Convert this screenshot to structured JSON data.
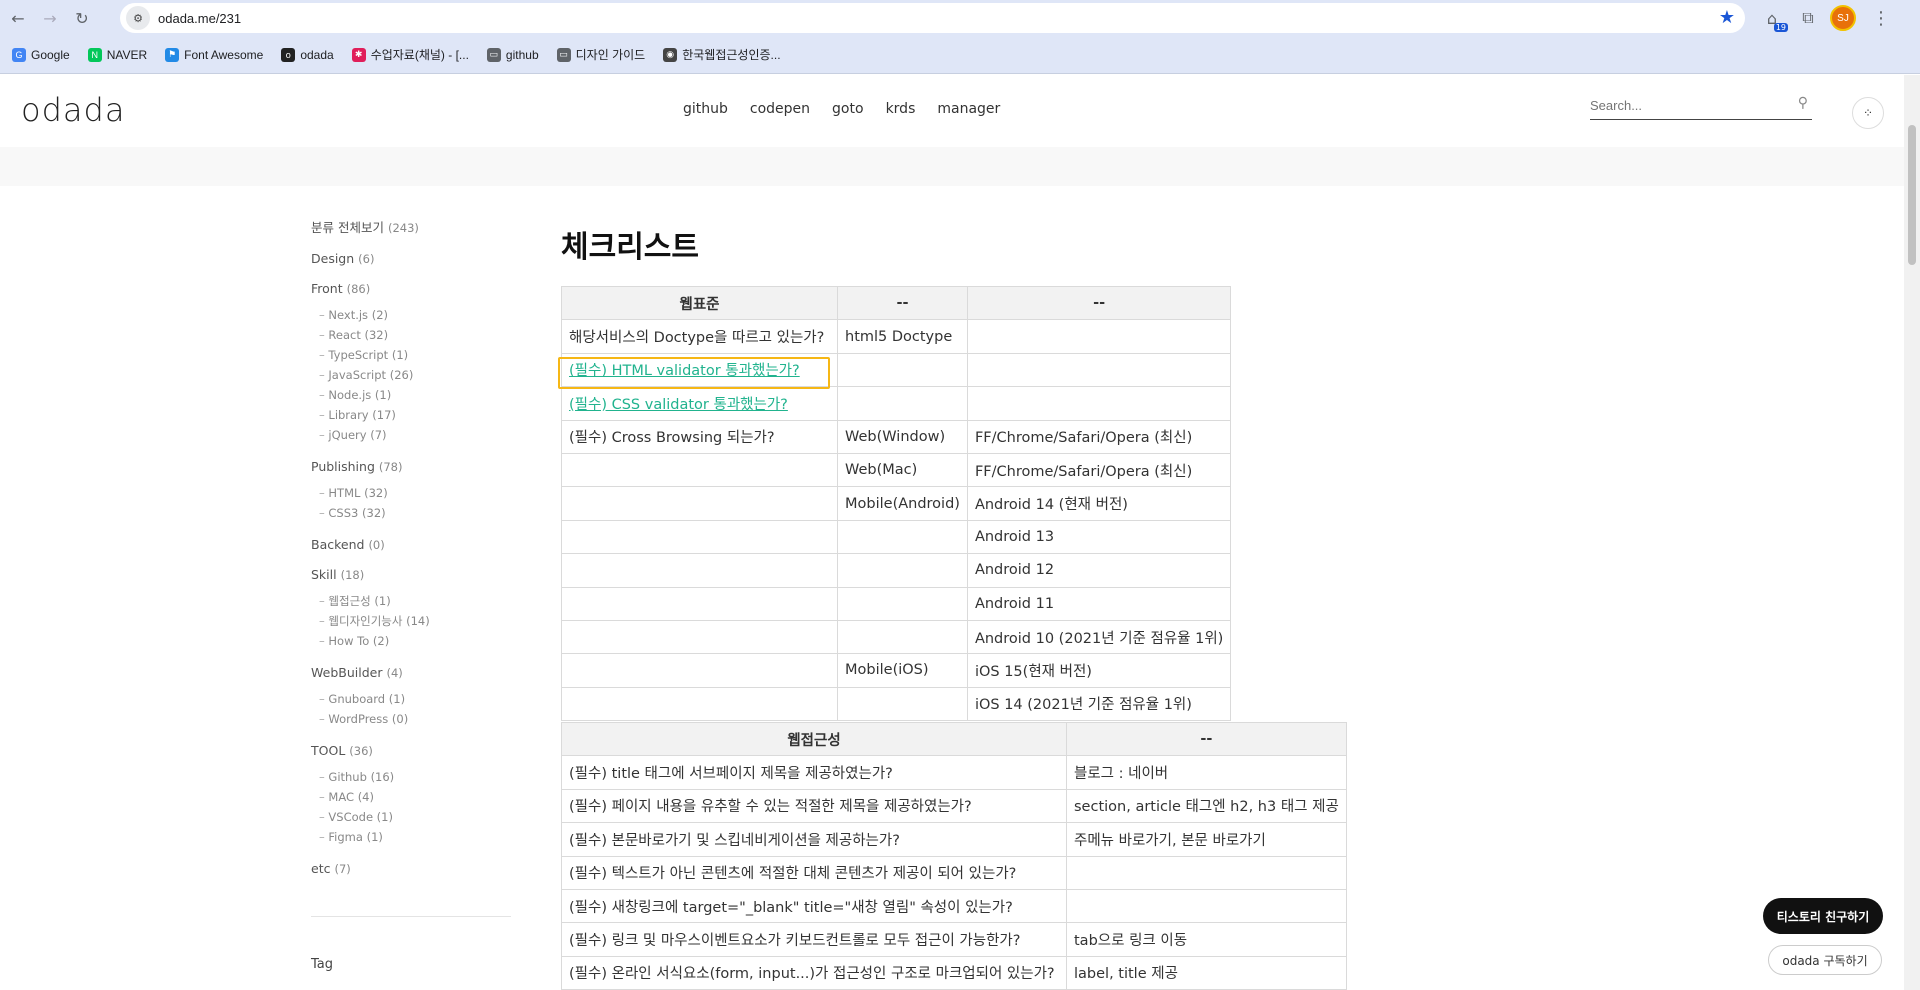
{
  "browser": {
    "url": "odada.me/231",
    "bookmarks": [
      {
        "label": "Google",
        "icon": "google-icon",
        "color": "#4285f4",
        "glyph": "G"
      },
      {
        "label": "NAVER",
        "icon": "naver-icon",
        "color": "#03c75a",
        "glyph": "N"
      },
      {
        "label": "Font Awesome",
        "icon": "flag-icon",
        "color": "#228ae6",
        "glyph": "⚑"
      },
      {
        "label": "odada",
        "icon": "odada-icon",
        "color": "#222222",
        "glyph": "o"
      },
      {
        "label": "수업자료(채널) - [...",
        "icon": "slack-icon",
        "color": "#e01e5a",
        "glyph": "✱"
      },
      {
        "label": "github",
        "icon": "folder-icon",
        "color": "#5f6368",
        "glyph": "▭"
      },
      {
        "label": "디자인 가이드",
        "icon": "folder-icon",
        "color": "#5f6368",
        "glyph": "▭"
      },
      {
        "label": "한국웹접근성인증...",
        "icon": "globe-icon",
        "color": "#444444",
        "glyph": "◉"
      }
    ],
    "extension_badge": "19",
    "profile_initials": "SJ"
  },
  "header": {
    "logo": "odada",
    "nav": [
      "github",
      "codepen",
      "goto",
      "krds",
      "manager"
    ],
    "search_placeholder": "Search..."
  },
  "sidebar": {
    "categories": [
      {
        "label": "분류 전체보기",
        "count": "(243)",
        "subs": []
      },
      {
        "label": "Design",
        "count": "(6)",
        "subs": []
      },
      {
        "label": "Front",
        "count": "(86)",
        "subs": [
          {
            "label": "Next.js",
            "count": "(2)"
          },
          {
            "label": "React",
            "count": "(32)"
          },
          {
            "label": "TypeScript",
            "count": "(1)"
          },
          {
            "label": "JavaScript",
            "count": "(26)"
          },
          {
            "label": "Node.js",
            "count": "(1)"
          },
          {
            "label": "Library",
            "count": "(17)"
          },
          {
            "label": "jQuery",
            "count": "(7)"
          }
        ]
      },
      {
        "label": "Publishing",
        "count": "(78)",
        "subs": [
          {
            "label": "HTML",
            "count": "(32)"
          },
          {
            "label": "CSS3",
            "count": "(32)"
          }
        ]
      },
      {
        "label": "Backend",
        "count": "(0)",
        "subs": []
      },
      {
        "label": "Skill",
        "count": "(18)",
        "subs": [
          {
            "label": "웹접근성",
            "count": "(1)"
          },
          {
            "label": "웹디자인기능사",
            "count": "(14)"
          },
          {
            "label": "How To",
            "count": "(2)"
          }
        ]
      },
      {
        "label": "WebBuilder",
        "count": "(4)",
        "subs": [
          {
            "label": "Gnuboard",
            "count": "(1)"
          },
          {
            "label": "WordPress",
            "count": "(0)"
          }
        ]
      },
      {
        "label": "TOOL",
        "count": "(36)",
        "subs": [
          {
            "label": "Github",
            "count": "(16)"
          },
          {
            "label": "MAC",
            "count": "(4)"
          },
          {
            "label": "VSCode",
            "count": "(1)"
          },
          {
            "label": "Figma",
            "count": "(1)"
          }
        ]
      },
      {
        "label": "etc",
        "count": "(7)",
        "subs": []
      }
    ],
    "tag_title": "Tag"
  },
  "post": {
    "title": "체크리스트",
    "table1": {
      "headers": [
        "웹표준",
        "--",
        "--"
      ],
      "rows": [
        [
          "해당서비스의 Doctype을 따르고 있는가?",
          "html5 Doctype",
          ""
        ],
        [
          "(필수) HTML validator 통과했는가?",
          "",
          ""
        ],
        [
          "(필수) CSS validator 통과했는가?",
          "",
          ""
        ],
        [
          "(필수) Cross Browsing 되는가?",
          "Web(Window)",
          "FF/Chrome/Safari/Opera (최신)"
        ],
        [
          "",
          "Web(Mac)",
          "FF/Chrome/Safari/Opera (최신)"
        ],
        [
          "",
          "Mobile(Android)",
          "Android 14 (현재 버전)"
        ],
        [
          "",
          "",
          "Android 13"
        ],
        [
          "",
          "",
          "Android 12"
        ],
        [
          "",
          "",
          "Android 11"
        ],
        [
          "",
          "",
          "Android 10 (2021년 기준 점유율 1위)"
        ],
        [
          "",
          "Mobile(iOS)",
          "iOS 15(현재 버전)"
        ],
        [
          "",
          "",
          "iOS 14 (2021년 기준 점유율 1위)"
        ]
      ]
    },
    "table2": {
      "headers": [
        "웹접근성",
        "--"
      ],
      "rows": [
        [
          "(필수) title 태그에 서브페이지 제목을 제공하였는가?",
          "블로그 : 네이버"
        ],
        [
          "(필수) 페이지 내용을 유추할 수 있는 적절한 제목을 제공하였는가?",
          "section, article 태그엔 h2, h3 태그 제공"
        ],
        [
          "(필수) 본문바로가기 및 스킵네비게이션을 제공하는가?",
          "주메뉴 바로가기, 본문 바로가기"
        ],
        [
          "(필수) 텍스트가 아닌 콘텐츠에 적절한 대체 콘텐츠가 제공이 되어 있는가?",
          ""
        ],
        [
          "(필수) 새창링크에 target=\"_blank\" title=\"새창 열림\" 속성이 있는가?",
          ""
        ],
        [
          "(필수) 링크 및 마우스이벤트요소가 키보드컨트롤로 모두 접근이 가능한가?",
          "tab으로 링크 이동"
        ],
        [
          "(필수) 온라인 서식요소(form, input...)가 접근성인 구조로 마크업되어 있는가?",
          "label, title 제공"
        ]
      ]
    }
  },
  "floating": {
    "friend_button": "티스토리 친구하기",
    "subscribe_button": "odada 구독하기"
  }
}
